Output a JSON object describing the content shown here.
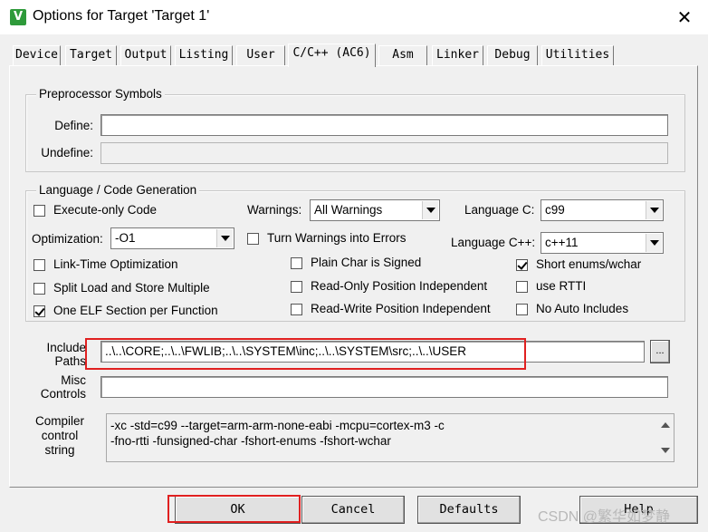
{
  "window": {
    "title": "Options for Target 'Target 1'",
    "close_glyph": "✕",
    "app_glyph": "V"
  },
  "tabs": [
    {
      "label": "Device"
    },
    {
      "label": "Target"
    },
    {
      "label": "Output"
    },
    {
      "label": "Listing"
    },
    {
      "label": "User"
    },
    {
      "label": "C/C++ (AC6)",
      "active": true
    },
    {
      "label": "Asm"
    },
    {
      "label": "Linker"
    },
    {
      "label": "Debug"
    },
    {
      "label": "Utilities"
    }
  ],
  "preprocessor": {
    "group_title": "Preprocessor Symbols",
    "define_label": "Define:",
    "define_value": "",
    "undefine_label": "Undefine:",
    "undefine_value": ""
  },
  "language": {
    "group_title": "Language / Code Generation",
    "execute_only": {
      "label": "Execute-only Code",
      "checked": false
    },
    "optimization_label": "Optimization:",
    "optimization_value": "-O1",
    "link_time": {
      "label": "Link-Time Optimization",
      "checked": false
    },
    "split_load": {
      "label": "Split Load and Store Multiple",
      "checked": false
    },
    "one_elf": {
      "label": "One ELF Section per Function",
      "checked": true
    },
    "warnings_label": "Warnings:",
    "warnings_value": "All Warnings",
    "turn_warnings": {
      "label": "Turn Warnings into Errors",
      "checked": false
    },
    "plain_char": {
      "label": "Plain Char is Signed",
      "checked": false
    },
    "ro_position": {
      "label": "Read-Only Position Independent",
      "checked": false
    },
    "rw_position": {
      "label": "Read-Write Position Independent",
      "checked": false
    },
    "language_c_label": "Language C:",
    "language_c_value": "c99",
    "language_cpp_label": "Language C++:",
    "language_cpp_value": "c++11",
    "short_enums": {
      "label": "Short enums/wchar",
      "checked": true
    },
    "use_rtti": {
      "label": "use RTTI",
      "checked": false
    },
    "no_auto_includes": {
      "label": "No Auto Includes",
      "checked": false
    }
  },
  "include": {
    "label_line1": "Include",
    "label_line2": "Paths",
    "value": "..\\..\\CORE;..\\..\\FWLIB;..\\..\\SYSTEM\\inc;..\\..\\SYSTEM\\src;..\\..\\USER",
    "browse_glyph": "..."
  },
  "misc": {
    "label_line1": "Misc",
    "label_line2": "Controls",
    "value": ""
  },
  "compiler": {
    "label_line1": "Compiler",
    "label_line2": "control",
    "label_line3": "string",
    "line1": "-xc -std=c99 --target=arm-arm-none-eabi -mcpu=cortex-m3 -c",
    "line2": "-fno-rtti -funsigned-char -fshort-enums -fshort-wchar"
  },
  "buttons": {
    "ok": "OK",
    "cancel": "Cancel",
    "defaults": "Defaults",
    "help": "Help"
  },
  "watermark": "CSDN @繁华如梦静",
  "colors": {
    "highlight": "#e02020",
    "dialog_bg": "#f0f0f0"
  }
}
